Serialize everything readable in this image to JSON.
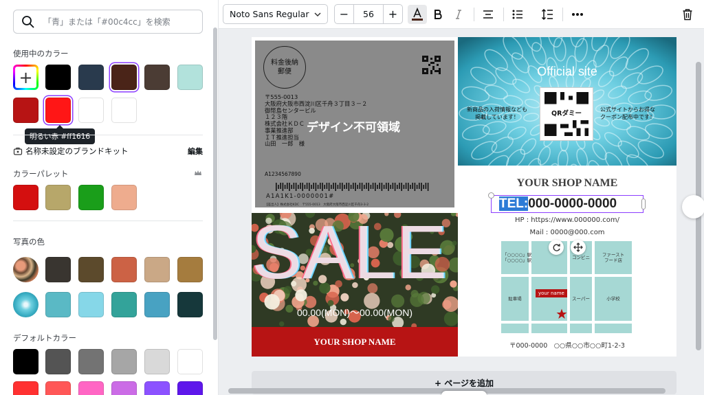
{
  "search": {
    "placeholder": "「青」または「#00c4cc」を検索"
  },
  "sections": {
    "in_use": "使用中のカラー",
    "brand_kit": "名称未設定のブランドキット",
    "brand_edit": "編集",
    "palette": "カラーパレット",
    "photo_colors": "写真の色",
    "default_colors": "デフォルトカラー"
  },
  "tooltip": "明るい赤 #ff1616",
  "colors": {
    "in_use": [
      "#000000",
      "#293a4d",
      "#4a2418",
      "#4b3c34",
      "#b2e2dc",
      "#b71414",
      "#ff1616",
      "#ffffff",
      "#ffffff"
    ],
    "selected": [
      "#4a2418",
      "#ff1616"
    ],
    "palette": [
      "#d40f0f",
      "#b7a76a",
      "#1a9e1a",
      "#eeac8e"
    ],
    "photo_row1": [
      "#393530",
      "#5c4a2c",
      "#cc6245",
      "#caa886",
      "#a57c3e"
    ],
    "photo_row2": [
      "#5ab9c5",
      "#86d7e8",
      "#33a39a",
      "#48a2c2",
      "#16383b"
    ],
    "default_row1": [
      "#000000",
      "#545454",
      "#737373",
      "#a6a6a6",
      "#d9d9d9",
      "#ffffff"
    ],
    "default_row2": [
      "#ff3131",
      "#ff5757",
      "#ff66c4",
      "#cb6ce6",
      "#8c52ff",
      "#5e17eb"
    ]
  },
  "toolbar": {
    "font": "Noto Sans Regular",
    "size": "56",
    "minus": "−",
    "plus": "+"
  },
  "postcard": {
    "stamp_line1": "料金後納",
    "stamp_line2": "郵便",
    "address": "〒555-0013\n大阪府大阪市西淀川区千舟３丁目３－２\n御幣島センタービル\n１２３階\n株式会社ＫＤＣ\n事業推進部\nＩＴ推進担当\n山田　一郎　様",
    "no_design_label": "デザイン不可領域",
    "postcode": "A1234567890",
    "barcode_text": "A1A1K1-0000001#",
    "footer_tiny": "【差出人】株式会社KDC　〒555-0013　大阪府大阪市西淀川区千舟3-3-2",
    "official_title": "Official site",
    "qr_label": "QRダミー",
    "side_left": "新商品の入荷情報なども\n掲載しています！",
    "side_right": "公式サイトからお得な\nクーポン配布中です！",
    "sale_word": "SALE",
    "sale_date": "00.00(MON)〜00.00(MON)",
    "sale_shop_name": "YOUR SHOP NAME",
    "shop_name": "YOUR SHOP NAME",
    "tel_prefix": "TEL:",
    "tel_number": "000-0000-0000",
    "hp": "HP : https://www.000000.com/",
    "mail": "Mail : 0000@000.com",
    "map_station1": "「○○○○」駅　徒歩00分\n「○○○○」駅　徒歩00分",
    "map_conveni": "コンビニ",
    "map_ff": "ファースト\nフード店",
    "map_parking": "駐車場",
    "map_super": "スーパー",
    "map_school": "小学校",
    "map_pin_label": "your name",
    "address_bottom": "〒000-0000　○○県○○市○○町1-2-3"
  },
  "add_page": "+ ページを追加"
}
